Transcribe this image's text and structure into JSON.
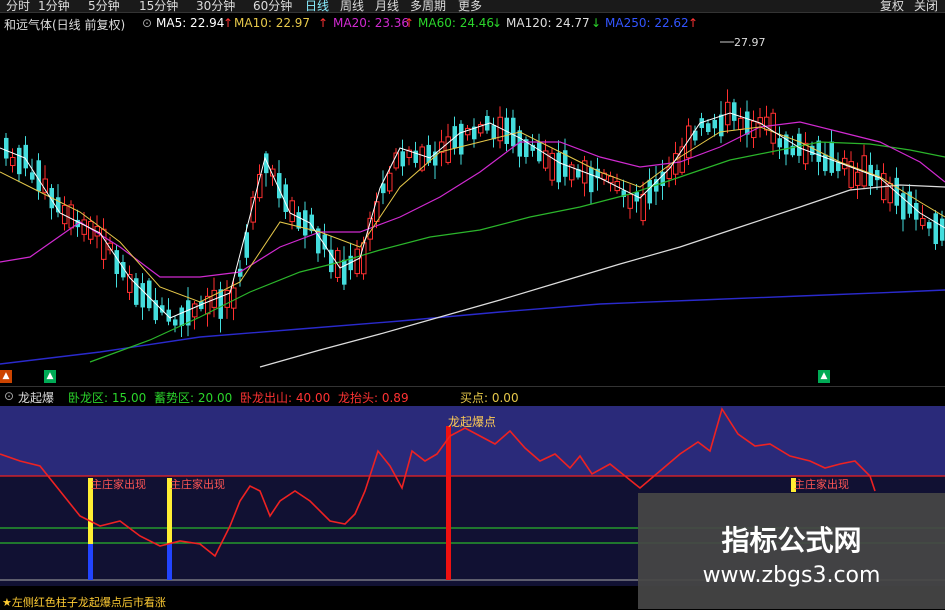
{
  "toolbar": {
    "tabs": [
      "分时",
      "1分钟",
      "5分钟",
      "15分钟",
      "30分钟",
      "60分钟",
      "日线",
      "周线",
      "月线",
      "多周期",
      "更多"
    ],
    "active_tab": "日线",
    "right_label": "复权",
    "close_label": "关闭"
  },
  "info": {
    "stock_name": "和远气体(日线 前复权)",
    "ma5": "MA5: 22.94",
    "ma10": "MA10: 22.97",
    "ma20": "MA20: 23.36",
    "ma60": "MA60: 24.46",
    "ma120": "MA120: 24.77",
    "ma250": "MA250: 22.62"
  },
  "main": {
    "high_marker": "27.97"
  },
  "indicator": {
    "name": "龙起爆",
    "wolong": "卧龙区: 15.00",
    "xushi": "蓄势区: 20.00",
    "chushan": "卧龙出山: 40.00",
    "taitou": "龙抬头: 0.89",
    "maidian": "买点: 0.00",
    "baodian_label": "龙起爆点",
    "zhuang_label": "主庄家出现"
  },
  "footer": {
    "note": "★左侧红色柱子龙起爆点后市看涨"
  },
  "watermark": {
    "title": "指标公式网",
    "url": "www.zbgs3.com"
  },
  "colors": {
    "ma5": "#ffffff",
    "ma10": "#e6c84a",
    "ma20": "#d02ad0",
    "ma60": "#2bb52b",
    "ma120": "#dddddd",
    "ma250": "#2a2acc",
    "candle_up": "#ff3030",
    "candle_down": "#44dddd",
    "indicator_bg": "#2a2a7a"
  },
  "chart_data": {
    "type": "candlestick",
    "title": "和远气体(日线 前复权)",
    "annotations": [
      "27.97"
    ],
    "series": [
      {
        "name": "MA5",
        "last": 22.94
      },
      {
        "name": "MA10",
        "last": 22.97
      },
      {
        "name": "MA20",
        "last": 23.36
      },
      {
        "name": "MA60",
        "last": 24.46
      },
      {
        "name": "MA120",
        "last": 24.77
      },
      {
        "name": "MA250",
        "last": 22.62
      }
    ]
  }
}
